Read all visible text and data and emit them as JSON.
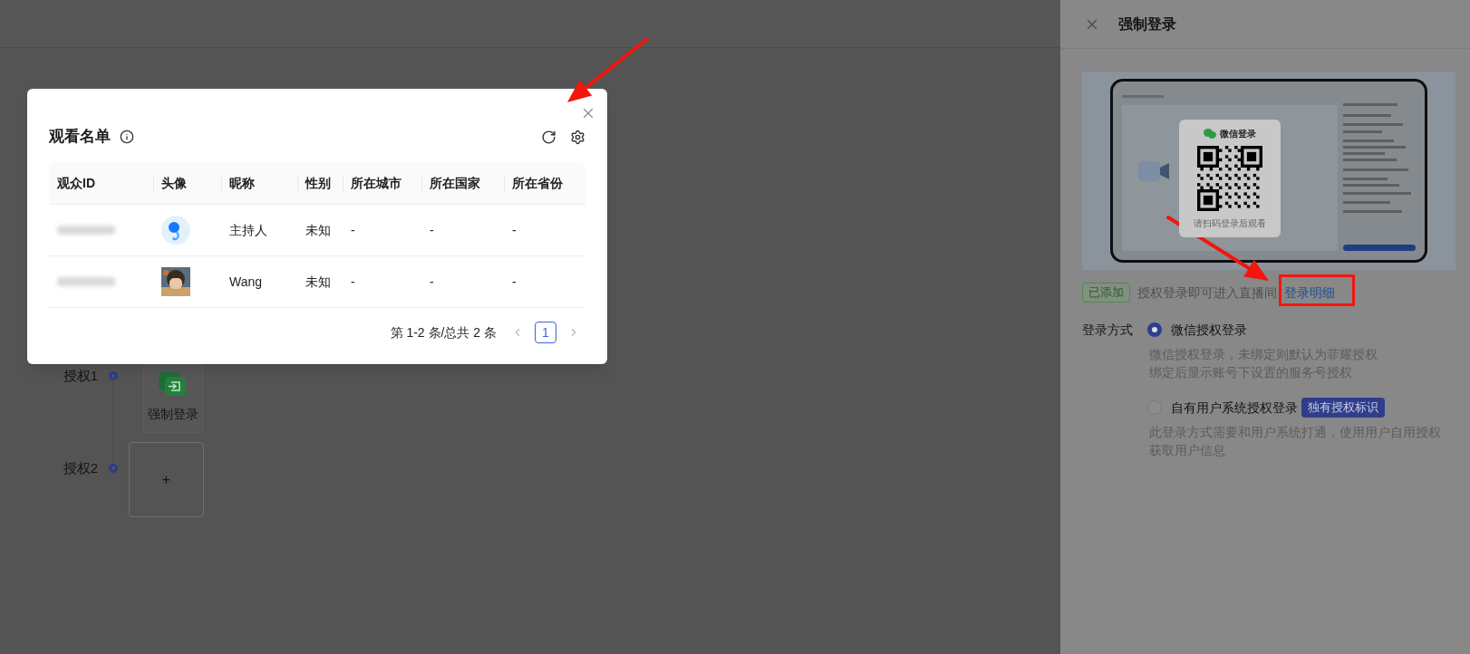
{
  "page": {
    "timeline": [
      {
        "label": "授权1",
        "card": {
          "kind": "method",
          "label": "强制登录"
        }
      },
      {
        "label": "授权2",
        "card": {
          "kind": "add",
          "label": "+"
        }
      }
    ]
  },
  "modal": {
    "title": "观看名单",
    "columns": [
      "观众ID",
      "头像",
      "昵称",
      "性别",
      "所在城市",
      "所在国家",
      "所在省份"
    ],
    "rows": [
      {
        "avatar": {
          "kind": "icon"
        },
        "nickname": "主持人",
        "gender": "未知",
        "city": "-",
        "country": "-",
        "province": "-"
      },
      {
        "nickname": "Wang",
        "gender": "未知",
        "city": "-",
        "country": "-",
        "province": "-"
      }
    ],
    "pagination": {
      "summary": "第 1-2 条/总共 2 条",
      "pages": [
        {
          "label": "1",
          "selected": true
        }
      ]
    }
  },
  "drawer": {
    "title": "强制登录",
    "preview": {
      "card_title": "微信登录",
      "card_hint": "请扫码登录后观看"
    },
    "status_badge": "已添加",
    "status_text": "授权登录即可进入直播间",
    "detail_link": "登录明细",
    "method_label": "登录方式",
    "options": [
      {
        "label": "微信授权登录",
        "selected": true,
        "description": [
          "微信授权登录，未绑定则默认为菲耀授权",
          "绑定后显示账号下设置的服务号授权"
        ]
      },
      {
        "label": "自有用户系统授权登录",
        "selected": false,
        "tag": "独有授权标识",
        "description": [
          "此登录方式需要和用户系统打通，使用用户自用授权获取用户信息"
        ]
      }
    ]
  }
}
